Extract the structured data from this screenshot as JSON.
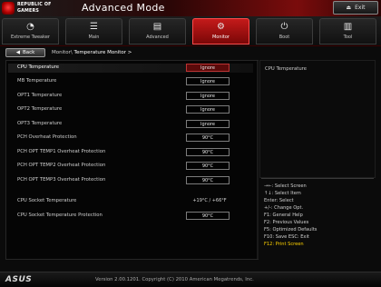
{
  "header": {
    "logo_line1": "REPUBLIC OF",
    "logo_line2": "GAMERS",
    "mode_title": "Advanced Mode",
    "exit_label": "Exit",
    "exit_icon": "exit-icon"
  },
  "tabs": [
    {
      "label": "Extreme Tweaker",
      "icon": "speedometer-icon",
      "glyph": "◔"
    },
    {
      "label": "Main",
      "icon": "list-icon",
      "glyph": "☰"
    },
    {
      "label": "Advanced",
      "icon": "chip-icon",
      "glyph": "▤"
    },
    {
      "label": "Monitor",
      "icon": "monitor-icon",
      "glyph": "⚙",
      "active": true
    },
    {
      "label": "Boot",
      "icon": "power-icon",
      "glyph": "⏻"
    },
    {
      "label": "Tool",
      "icon": "tool-icon",
      "glyph": "▥"
    }
  ],
  "breadcrumb": {
    "back_label": "Back",
    "parent": "Monitor\\",
    "current": "Temperature Monitor >"
  },
  "rows": [
    {
      "label": "CPU Temperature",
      "value": "Ignore",
      "selected": true
    },
    {
      "label": "MB Temperature",
      "value": "Ignore"
    },
    {
      "label": "OPT1 Temperature",
      "value": "Ignore"
    },
    {
      "label": "OPT2 Temperature",
      "value": "Ignore"
    },
    {
      "label": "OPT3 Temperature",
      "value": "Ignore"
    },
    {
      "label": "PCH Overheat Protection",
      "value": "90°C"
    },
    {
      "label": "PCH OPT TEMP1 Overheat Protection",
      "value": "90°C"
    },
    {
      "label": "PCH OPT TEMP2 Overheat Protection",
      "value": "90°C"
    },
    {
      "label": "PCH OPT TEMP3 Overheat Protection",
      "value": "90°C"
    }
  ],
  "socket_rows": [
    {
      "label": "CPU Socket Temperature",
      "readout": "+19°C / +66°F"
    },
    {
      "label": "CPU Socket Temperature Protection",
      "value": "90°C"
    }
  ],
  "help": {
    "title": "CPU Temperature"
  },
  "keys": [
    "→←: Select Screen",
    "↑↓: Select Item",
    "Enter: Select",
    "+/-: Change Opt.",
    "F1: General Help",
    "F2: Previous Values",
    "F5: Optimized Defaults",
    "F10: Save  ESC: Exit",
    "F12: Print Screen"
  ],
  "footer": {
    "brand": "ASUS",
    "version": "Version 2.00.1201. Copyright (C) 2010 American Megatrends, Inc."
  },
  "colors": {
    "accent_red": "#c41a1a",
    "highlight_yellow": "#ffd200"
  }
}
